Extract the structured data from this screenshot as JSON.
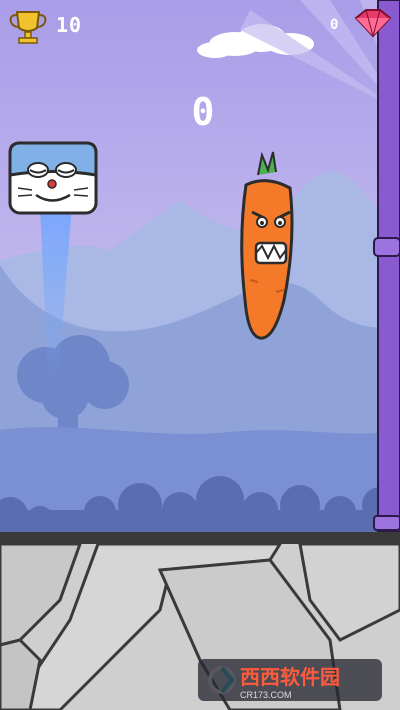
{
  "hud": {
    "trophy_icon": "trophy-icon",
    "trophy_count": "10",
    "gem_icon": "gem-icon",
    "gem_count": "0"
  },
  "game": {
    "score": "0",
    "player_character": "cat-block",
    "enemy_character": "angry-carrot"
  },
  "colors": {
    "sky": "#b9b0ea",
    "hills": "#8fa3d8",
    "ground_dark": "#5a6db0",
    "floor": "#cfcfcf",
    "pillar": "#8a5bd0"
  },
  "watermark": {
    "brand": "西西软件园",
    "site": "CR173.COM"
  }
}
